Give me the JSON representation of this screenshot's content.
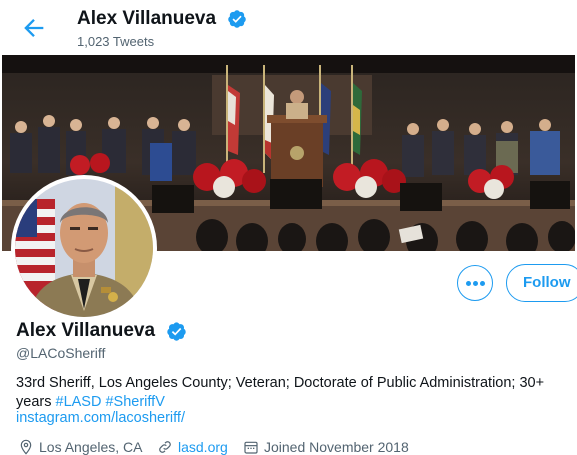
{
  "header": {
    "back_icon": "arrow-left-icon",
    "title": "Alex Villanueva",
    "tweet_count": "1,023 Tweets"
  },
  "banner": {
    "description": ""
  },
  "actions": {
    "more_icon": "more-horizontal-icon",
    "follow_label": "Follow"
  },
  "profile": {
    "name": "Alex Villanueva",
    "verified_icon": "verified-badge-icon",
    "handle": "@LACoSheriff",
    "bio_text": "33rd Sheriff, Los Angeles County; Veteran; Doctorate of Public Administration; 30+ years ",
    "hashtag_1": "#LASD",
    "hashtag_2": "#SheriffV",
    "website_display": "instagram.com/lacosheriff/",
    "location": "Los Angeles, CA",
    "website": "lasd.org",
    "joined": "Joined November 2018"
  },
  "colors": {
    "accent": "#1d9bf0",
    "secondary_text": "#536471",
    "primary_text": "#0f1419"
  }
}
